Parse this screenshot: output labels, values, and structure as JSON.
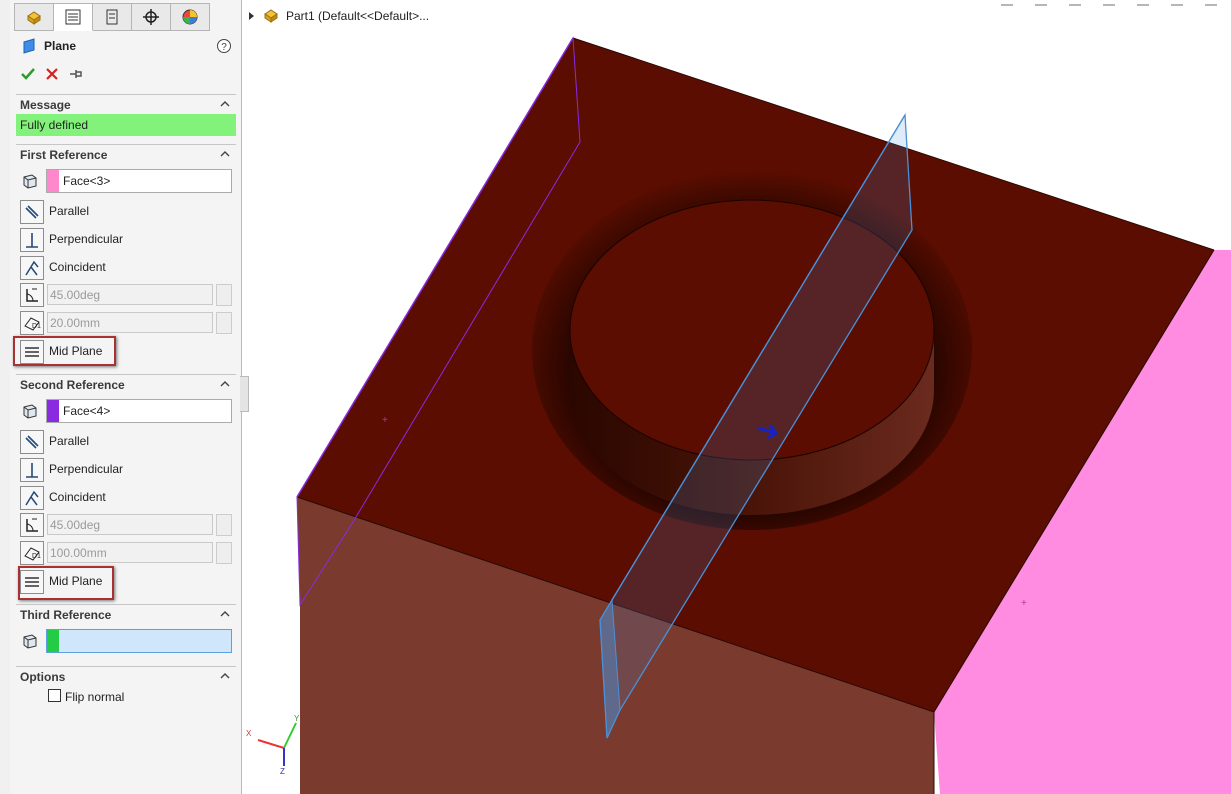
{
  "panel": {
    "title": "Plane",
    "tabs": [
      "feature-manager-icon",
      "property-manager-icon",
      "configuration-manager-icon",
      "dimxpert-icon",
      "display-manager-icon"
    ],
    "message": {
      "header": "Message",
      "text": "Fully defined",
      "color": "#82f27a"
    },
    "first_reference": {
      "header": "First Reference",
      "selection": "Face<3>",
      "swatch": "#ff88cc",
      "options": [
        "Parallel",
        "Perpendicular",
        "Coincident"
      ],
      "angle": "45.00deg",
      "distance": "20.00mm",
      "mid_plane": "Mid Plane"
    },
    "second_reference": {
      "header": "Second Reference",
      "selection": "Face<4>",
      "swatch": "#8a2be2",
      "options": [
        "Parallel",
        "Perpendicular",
        "Coincident"
      ],
      "angle": "45.00deg",
      "distance": "100.00mm",
      "mid_plane": "Mid Plane"
    },
    "third_reference": {
      "header": "Third Reference",
      "selection": "",
      "swatch": "#22cc44"
    },
    "options": {
      "header": "Options",
      "flip_normal": "Flip normal"
    }
  },
  "graphics": {
    "breadcrumb": "Part1  (Default<<Default>...",
    "colors": {
      "top_face": "#5a0d00",
      "front_face": "#7a3a2e",
      "side_face": "#ff8ce0",
      "plane": "#4a90d9"
    }
  }
}
